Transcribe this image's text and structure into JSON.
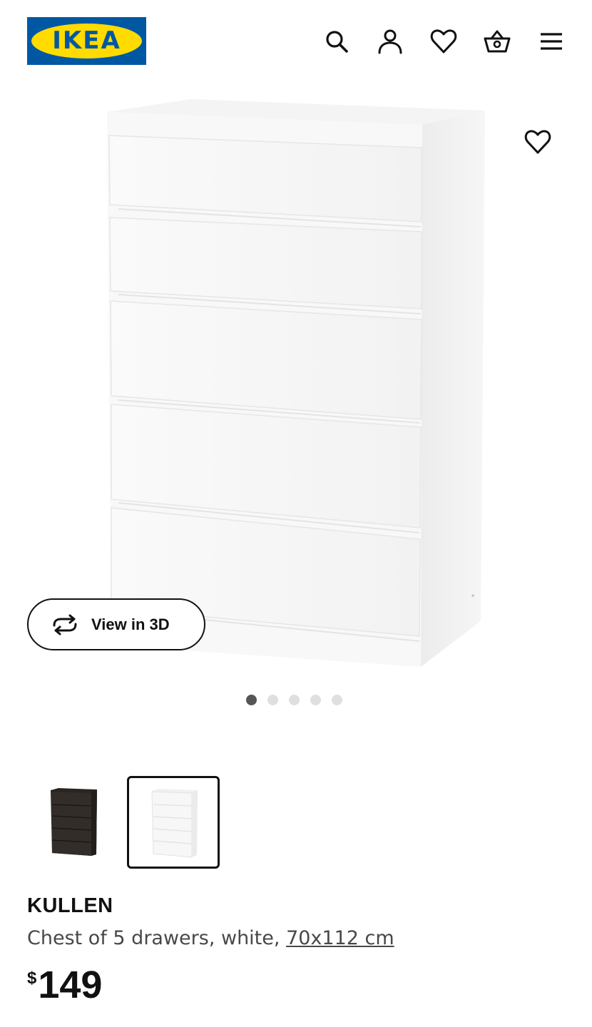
{
  "header": {
    "logo_text": "IKEA",
    "logo_mark": "®",
    "icons": [
      "search-icon",
      "account-icon",
      "favorites-icon",
      "basket-icon",
      "menu-icon"
    ],
    "colors": {
      "logo_blue": "#0058a3",
      "logo_yellow": "#ffdb00"
    }
  },
  "gallery": {
    "view_3d_label": "View in 3D",
    "view_3d_icon": "rotate-icon",
    "favorite_icon": "heart-icon",
    "slide_count": 5,
    "active_slide": 1
  },
  "variants": [
    {
      "color": "black-brown",
      "selected": false
    },
    {
      "color": "white",
      "selected": true
    }
  ],
  "product": {
    "name": "KULLEN",
    "description": "Chest of 5 drawers, white, ",
    "size": "70x112 cm",
    "currency": "$",
    "price": "149"
  }
}
